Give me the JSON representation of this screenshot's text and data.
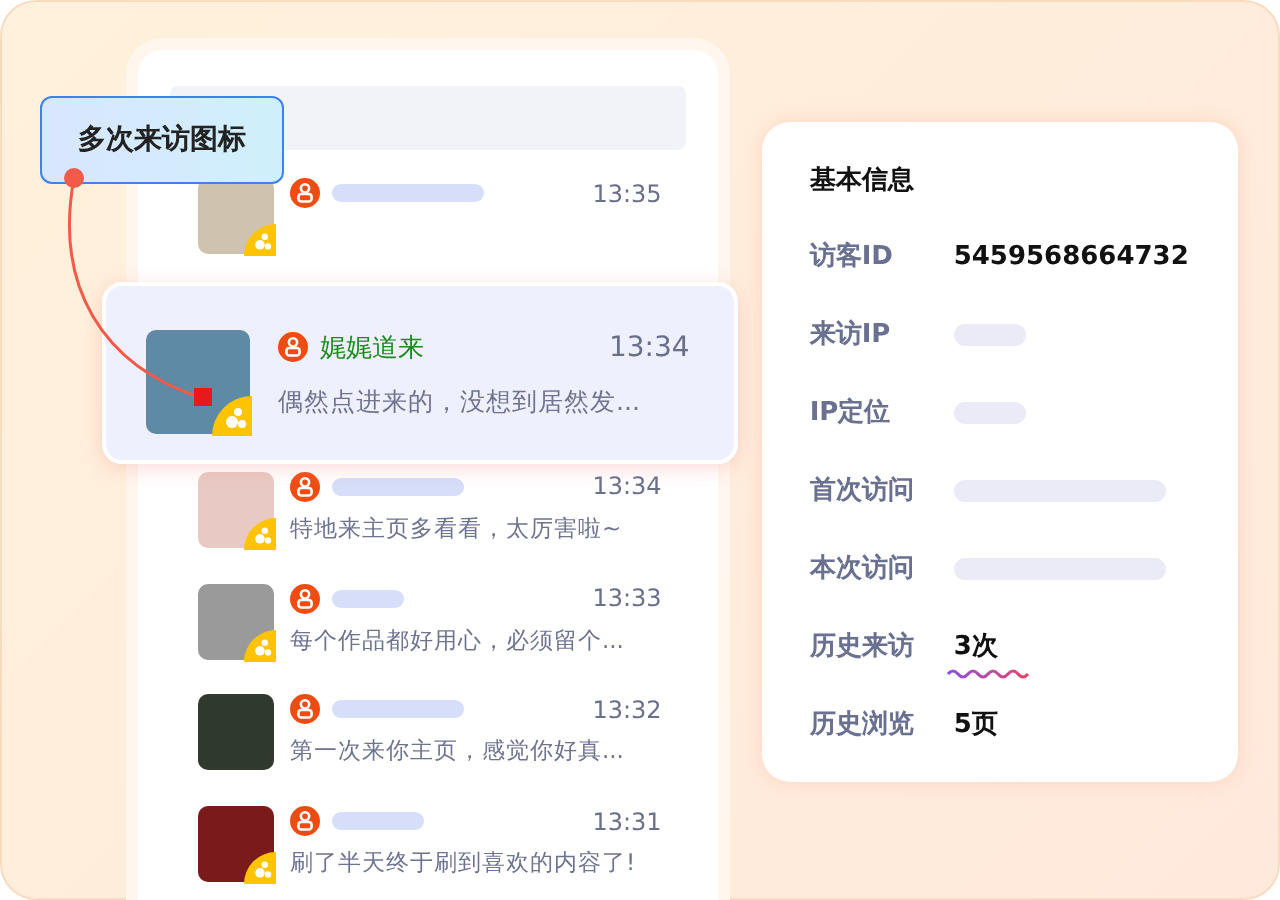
{
  "callout": {
    "label": "多次来访图标"
  },
  "visitors": [
    {
      "time": "13:35",
      "repeat_visitor": true,
      "highlighted": false
    },
    {
      "name": "娓娓道来",
      "time": "13:34",
      "message": "偶然点进来的，没想到居然发...",
      "repeat_visitor": true,
      "highlighted": true
    },
    {
      "time": "13:34",
      "message": "特地来主页多看看，太厉害啦~",
      "repeat_visitor": true,
      "highlighted": false
    },
    {
      "time": "13:33",
      "message": "每个作品都好用心，必须留个...",
      "repeat_visitor": true,
      "highlighted": false
    },
    {
      "time": "13:32",
      "message": "第一次来你主页，感觉你好真...",
      "repeat_visitor": false,
      "highlighted": false
    },
    {
      "time": "13:31",
      "message": "刷了半天终于刷到喜欢的内容了!",
      "repeat_visitor": true,
      "highlighted": false
    }
  ],
  "info": {
    "title": "基本信息",
    "rows": [
      {
        "label": "访客ID",
        "kind": "text",
        "value": "5459568664732",
        "emphasized": false
      },
      {
        "label": "来访IP",
        "kind": "redacted"
      },
      {
        "label": "IP定位",
        "kind": "redacted"
      },
      {
        "label": "首次访问",
        "kind": "redacted_long"
      },
      {
        "label": "本次访问",
        "kind": "redacted_long"
      },
      {
        "label": "历史来访",
        "kind": "text",
        "value": "3次",
        "emphasized": true
      },
      {
        "label": "历史浏览",
        "kind": "text",
        "value": "5页",
        "emphasized": false
      }
    ]
  }
}
